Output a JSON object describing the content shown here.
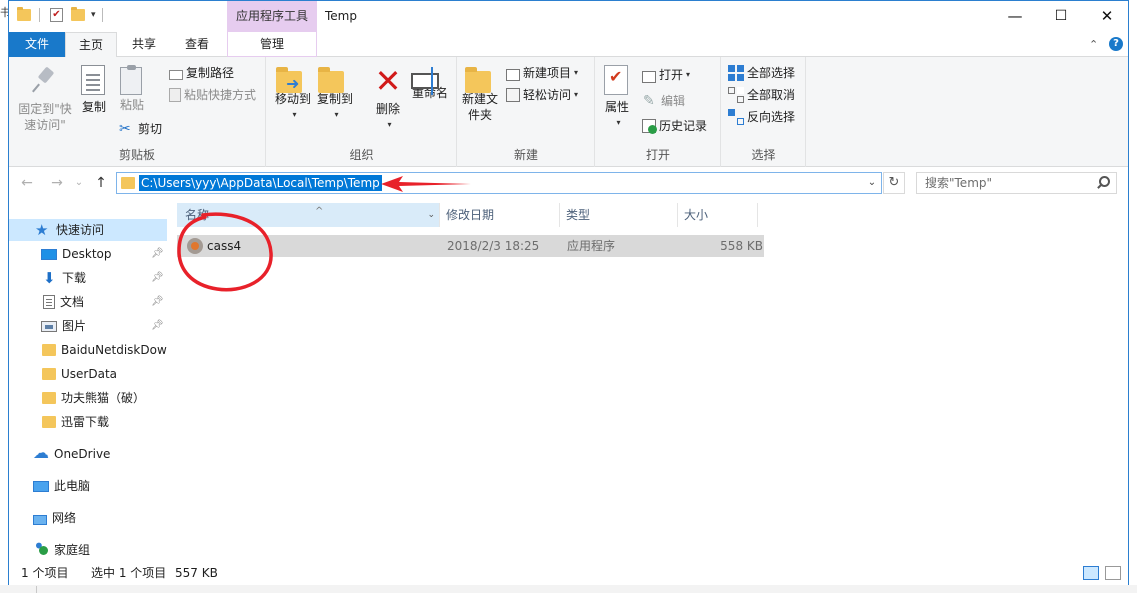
{
  "window": {
    "title": "Temp",
    "context_tab": "应用程序工具",
    "minimize": "—",
    "maximize": "☐",
    "close": "✕",
    "left_edge_char": "书"
  },
  "tabs": {
    "file": "文件",
    "home": "主页",
    "share": "共享",
    "view": "查看",
    "manage": "管理",
    "collapse_glyph": "⌃",
    "help_glyph": "?"
  },
  "ribbon": {
    "clipboard": {
      "label": "剪贴板",
      "pin_quick": "固定到\"快速访问\"",
      "copy": "复制",
      "paste": "粘贴",
      "copy_path": "复制路径",
      "paste_shortcut": "粘贴快捷方式",
      "cut": "剪切"
    },
    "organize": {
      "label": "组织",
      "move_to": "移动到",
      "copy_to": "复制到",
      "delete": "删除",
      "rename": "重命名"
    },
    "new": {
      "label": "新建",
      "new_folder": "新建文件夹",
      "new_item": "新建项目",
      "easy_access": "轻松访问"
    },
    "open": {
      "label": "打开",
      "properties": "属性",
      "open": "打开",
      "edit": "编辑",
      "history": "历史记录"
    },
    "select": {
      "label": "选择",
      "select_all": "全部选择",
      "select_none": "全部取消",
      "invert": "反向选择"
    }
  },
  "nav": {
    "back": "←",
    "forward": "→",
    "recent": "⌄",
    "up": "↑",
    "address": "C:\\Users\\yyy\\AppData\\Local\\Temp\\Temp",
    "refresh": "↻",
    "search_placeholder": "搜索\"Temp\""
  },
  "sidebar": {
    "quick_access": "快速访问",
    "items": [
      {
        "label": "Desktop",
        "pinned": true
      },
      {
        "label": "下载",
        "pinned": true
      },
      {
        "label": "文档",
        "pinned": true
      },
      {
        "label": "图片",
        "pinned": true
      },
      {
        "label": "BaiduNetdiskDow",
        "pinned": false
      },
      {
        "label": "UserData",
        "pinned": false
      },
      {
        "label": "功夫熊猫（破）",
        "pinned": false
      },
      {
        "label": "迅雷下载",
        "pinned": false
      }
    ],
    "onedrive": "OneDrive",
    "this_pc": "此电脑",
    "network": "网络",
    "homegroup": "家庭组"
  },
  "filelist": {
    "columns": {
      "name": "名称",
      "modified": "修改日期",
      "type": "类型",
      "size": "大小"
    },
    "sort_glyph": "^",
    "rows": [
      {
        "name": "cass4",
        "modified": "2018/2/3 18:25",
        "type": "应用程序",
        "size": "558 KB"
      }
    ]
  },
  "status": {
    "count": "1 个项目",
    "selected": "选中 1 个项目",
    "size": "557 KB"
  },
  "colors": {
    "accent": "#1979ca",
    "selection": "#cce8ff",
    "context_tab": "#e6ccef",
    "annotation": "#e8212a"
  }
}
